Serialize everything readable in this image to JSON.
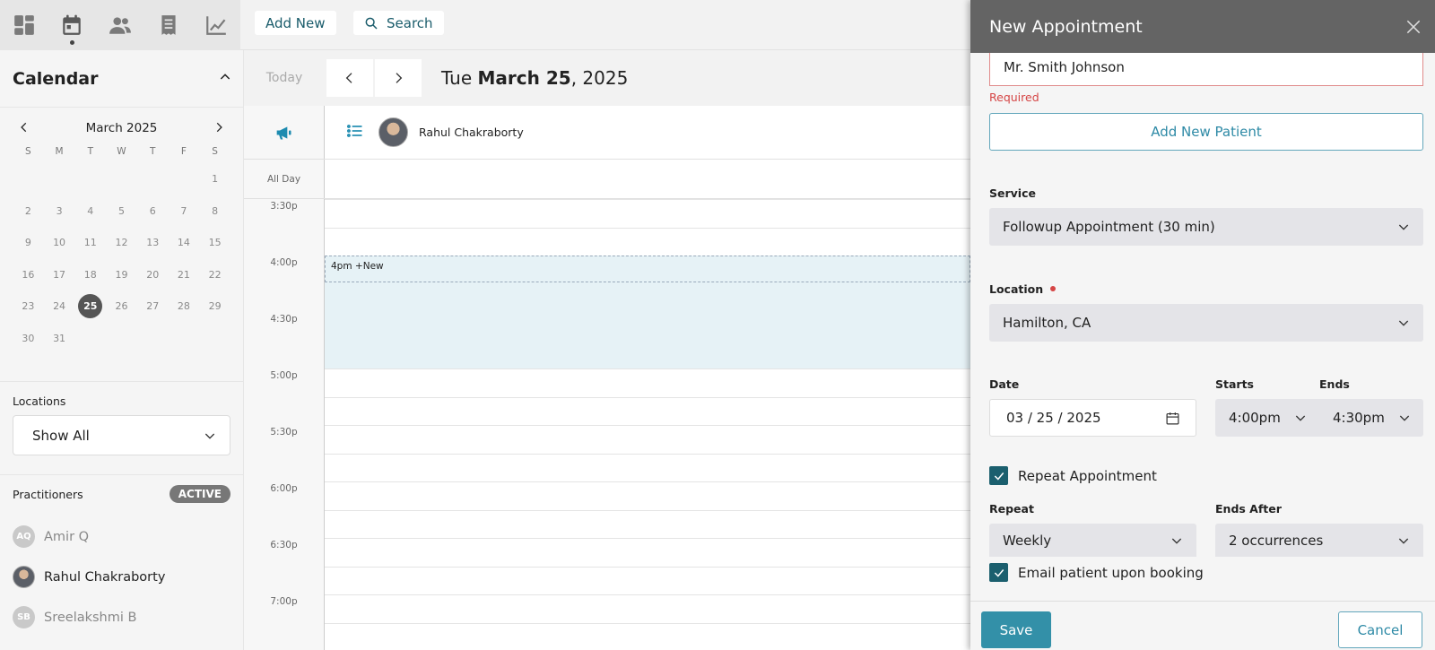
{
  "topbar": {
    "add_new_label": "Add New",
    "search_label": "Search"
  },
  "nav": {
    "icons": [
      "dashboard-icon",
      "calendar-icon",
      "people-icon",
      "receipt-icon",
      "chart-icon"
    ],
    "active": "calendar-icon"
  },
  "sidebar": {
    "title": "Calendar",
    "month_label": "March 2025",
    "dow": [
      "S",
      "M",
      "T",
      "W",
      "T",
      "F",
      "S"
    ],
    "weeks": [
      [
        "",
        "",
        "",
        "",
        "",
        "",
        "1"
      ],
      [
        "2",
        "3",
        "4",
        "5",
        "6",
        "7",
        "8"
      ],
      [
        "9",
        "10",
        "11",
        "12",
        "13",
        "14",
        "15"
      ],
      [
        "16",
        "17",
        "18",
        "19",
        "20",
        "21",
        "22"
      ],
      [
        "23",
        "24",
        "25",
        "26",
        "27",
        "28",
        "29"
      ],
      [
        "30",
        "31",
        "",
        "",
        "",
        "",
        ""
      ]
    ],
    "selected_day": "25",
    "locations_label": "Locations",
    "location_value": "Show All",
    "practitioners_label": "Practitioners",
    "practitioners_badge": "ACTIVE",
    "practitioners": [
      {
        "initials": "AQ",
        "name": "Amir Q",
        "active": false
      },
      {
        "initials": "",
        "name": "Rahul Chakraborty",
        "active": true
      },
      {
        "initials": "SB",
        "name": "Sreelakshmi B",
        "active": false
      }
    ]
  },
  "main": {
    "today_label": "Today",
    "date_prefix": "Tue",
    "date_bold": "March 25",
    "date_suffix": ", 2025",
    "column_practitioner": "Rahul Chakraborty",
    "all_day_label": "All Day",
    "time_slots": [
      "3:30p",
      "",
      "4:00p",
      "",
      "4:30p",
      "",
      "5:00p",
      "",
      "5:30p",
      "",
      "6:00p",
      "",
      "6:30p",
      "",
      "7:00p",
      ""
    ],
    "new_slot_label": "4pm +New"
  },
  "panel": {
    "title": "New Appointment",
    "patient_value": "Mr. Smith Johnson",
    "required_text": "Required",
    "add_patient_label": "Add New Patient",
    "service_label": "Service",
    "service_value": "Followup Appointment (30 min)",
    "location_label": "Location",
    "location_value": "Hamilton, CA",
    "date_label": "Date",
    "date_value": "03 / 25 / 2025",
    "starts_label": "Starts",
    "starts_value": "4:00pm",
    "ends_label": "Ends",
    "ends_value": "4:30pm",
    "repeat_check_label": "Repeat Appointment",
    "repeat_label": "Repeat",
    "repeat_value": "Weekly",
    "ends_after_label": "Ends After",
    "ends_after_value": "2 occurrences",
    "email_check_label": "Email patient upon booking",
    "save_label": "Save",
    "cancel_label": "Cancel"
  }
}
